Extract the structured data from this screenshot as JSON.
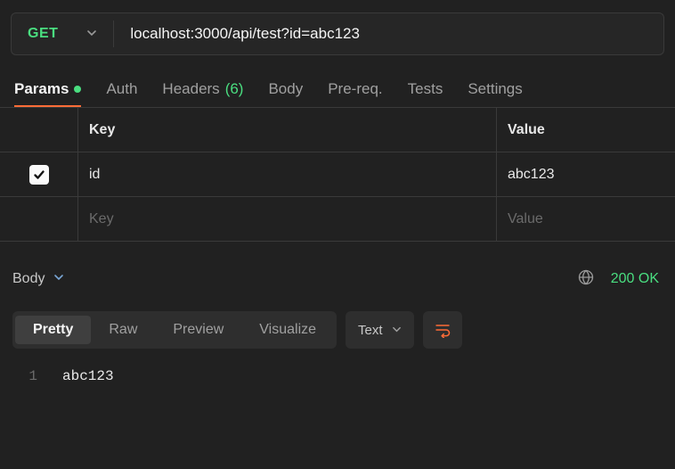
{
  "request": {
    "method": "GET",
    "url": "localhost:3000/api/test?id=abc123"
  },
  "tabs": {
    "params": "Params",
    "auth": "Auth",
    "headers": "Headers",
    "headers_count": "(6)",
    "body": "Body",
    "prereq": "Pre-req.",
    "tests": "Tests",
    "settings": "Settings"
  },
  "params_table": {
    "key_header": "Key",
    "value_header": "Value",
    "rows": [
      {
        "key": "id",
        "value": "abc123",
        "checked": true
      }
    ],
    "placeholder_key": "Key",
    "placeholder_value": "Value"
  },
  "response": {
    "section_label": "Body",
    "status": "200 OK",
    "format_tabs": {
      "pretty": "Pretty",
      "raw": "Raw",
      "preview": "Preview",
      "visualize": "Visualize"
    },
    "content_type": "Text",
    "lines": [
      {
        "n": "1",
        "text": "abc123"
      }
    ]
  }
}
